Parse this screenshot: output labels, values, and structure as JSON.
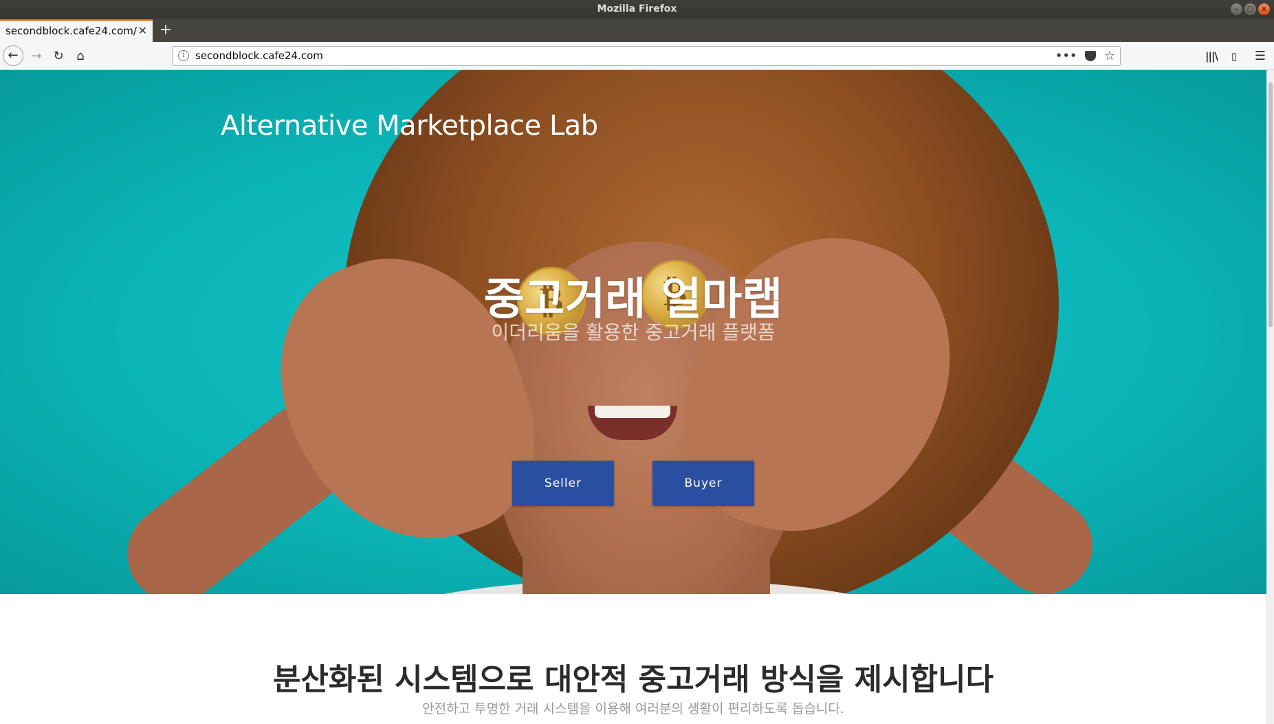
{
  "window": {
    "title": "Mozilla Firefox"
  },
  "tab": {
    "label": "secondblock.cafe24.com/",
    "close_glyph": "✕",
    "new_tab_glyph": "+"
  },
  "urlbar": {
    "url": "secondblock.cafe24.com",
    "info_glyph": "i",
    "dots_glyph": "•••",
    "star_glyph": "☆"
  },
  "nav": {
    "back_glyph": "←",
    "forward_glyph": "→",
    "reload_glyph": "↻",
    "home_glyph": "⌂"
  },
  "tools": {
    "library_glyph": "|||\\",
    "sidebar_glyph": "▯",
    "menu_glyph": "☰"
  },
  "hero": {
    "brand": "Alternative Marketplace Lab",
    "title": "중고거래 얼마랩",
    "subtitle": "이더리움을 활용한 중고거래 플랫폼",
    "seller_label": "Seller",
    "buyer_label": "Buyer",
    "coin_glyph": "₿"
  },
  "section": {
    "title": "분산화된 시스템으로 대안적 중고거래 방식을 제시합니다",
    "subtitle": "안전하고 투명한 거래 시스템을 이용해 여러분의 생활이 편리하도록 돕습니다."
  },
  "colors": {
    "hero_bg": "#0bb5b7",
    "button": "#2a4ea2",
    "tab_accent": "#e66000"
  }
}
